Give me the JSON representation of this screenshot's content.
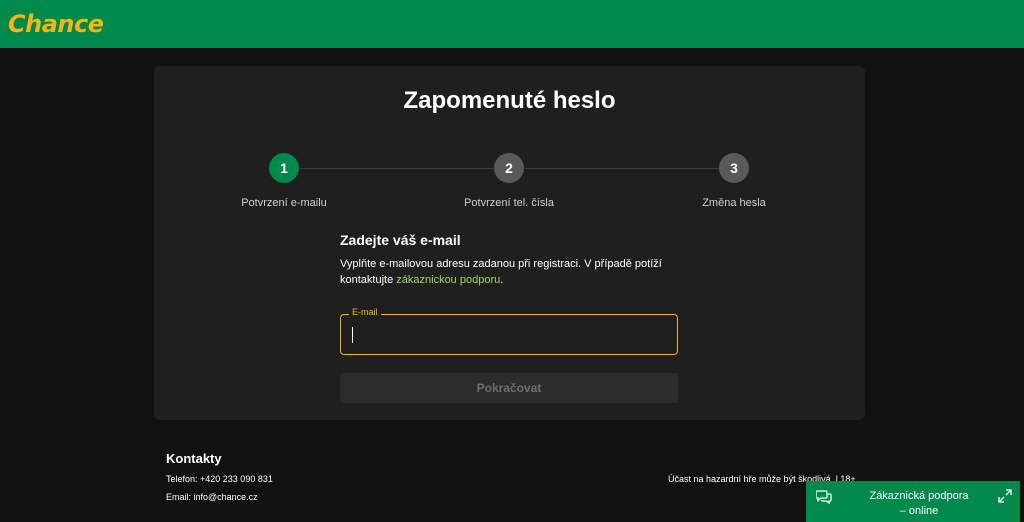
{
  "brand": {
    "logo_text": "Chance",
    "accent": "#f6b31a",
    "primary": "#00894a"
  },
  "page": {
    "title": "Zapomenuté heslo"
  },
  "stepper": {
    "steps": [
      {
        "number": "1",
        "label": "Potvrzení e-mailu",
        "active": true
      },
      {
        "number": "2",
        "label": "Potvrzení tel. čísla",
        "active": false
      },
      {
        "number": "3",
        "label": "Změna hesla",
        "active": false
      }
    ]
  },
  "form": {
    "heading": "Zadejte váš e-mail",
    "description_before": "Vyplňte e-mailovou adresu zadanou při registraci. V případě potíží kontaktujte ",
    "description_link": "zákaznickou podporu",
    "description_after": ".",
    "email_label": "E-mail",
    "email_value": "",
    "submit_label": "Pokračovat"
  },
  "footer": {
    "contacts_title": "Kontakty",
    "phone": "Telefon: +420 233 090 831",
    "email": "Email: info@chance.cz",
    "legal": "Účast na hazardní hře může být škodlivá. | 18+"
  },
  "support_widget": {
    "line1": "Zákaznická podpora",
    "line2": "– online",
    "chat_icon": "chat-icon",
    "expand_icon": "expand-icon"
  }
}
